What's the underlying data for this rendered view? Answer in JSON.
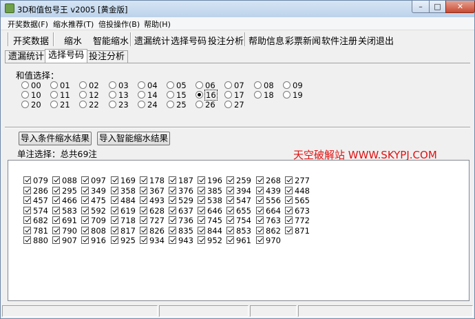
{
  "window": {
    "title": "3D和值包号王 v2005 [黄金版]"
  },
  "menu": [
    "开奖数据(F)",
    "缩水推荐(T)",
    "倍投操作(B)",
    "帮助(H)"
  ],
  "toolbar": [
    "开奖数据",
    "缩水",
    "智能缩水",
    "遗漏统计",
    "选择号码",
    "投注分析",
    "帮助信息",
    "彩票新闻",
    "软件注册",
    "关闭退出"
  ],
  "tabs": [
    "遗漏统计",
    "选择号码",
    "投注分析"
  ],
  "active_tab": "选择号码",
  "sum_select": {
    "label": "和值选择：",
    "options": [
      "00",
      "01",
      "02",
      "03",
      "04",
      "05",
      "06",
      "07",
      "08",
      "09",
      "10",
      "11",
      "12",
      "13",
      "14",
      "15",
      "16",
      "17",
      "18",
      "19",
      "20",
      "21",
      "22",
      "23",
      "24",
      "25",
      "26",
      "27"
    ],
    "selected": "16"
  },
  "buttons": {
    "import_condition": "导入条件缩水结果",
    "import_smart": "导入智能缩水结果"
  },
  "count_text": "单注选择：总共69注",
  "watermark": "天空破解站 WWW.SKYPJ.COM",
  "numbers": [
    "079",
    "088",
    "097",
    "169",
    "178",
    "187",
    "196",
    "259",
    "268",
    "277",
    "286",
    "295",
    "349",
    "358",
    "367",
    "376",
    "385",
    "394",
    "439",
    "448",
    "457",
    "466",
    "475",
    "484",
    "493",
    "529",
    "538",
    "547",
    "556",
    "565",
    "574",
    "583",
    "592",
    "619",
    "628",
    "637",
    "646",
    "655",
    "664",
    "673",
    "682",
    "691",
    "709",
    "718",
    "727",
    "736",
    "745",
    "754",
    "763",
    "772",
    "781",
    "790",
    "808",
    "817",
    "826",
    "835",
    "844",
    "853",
    "862",
    "871",
    "880",
    "907",
    "916",
    "925",
    "934",
    "943",
    "952",
    "961",
    "970"
  ],
  "icons": {
    "app": "app-icon",
    "minimize": "minimize-icon",
    "maximize": "maximize-icon",
    "close": "close-icon"
  }
}
